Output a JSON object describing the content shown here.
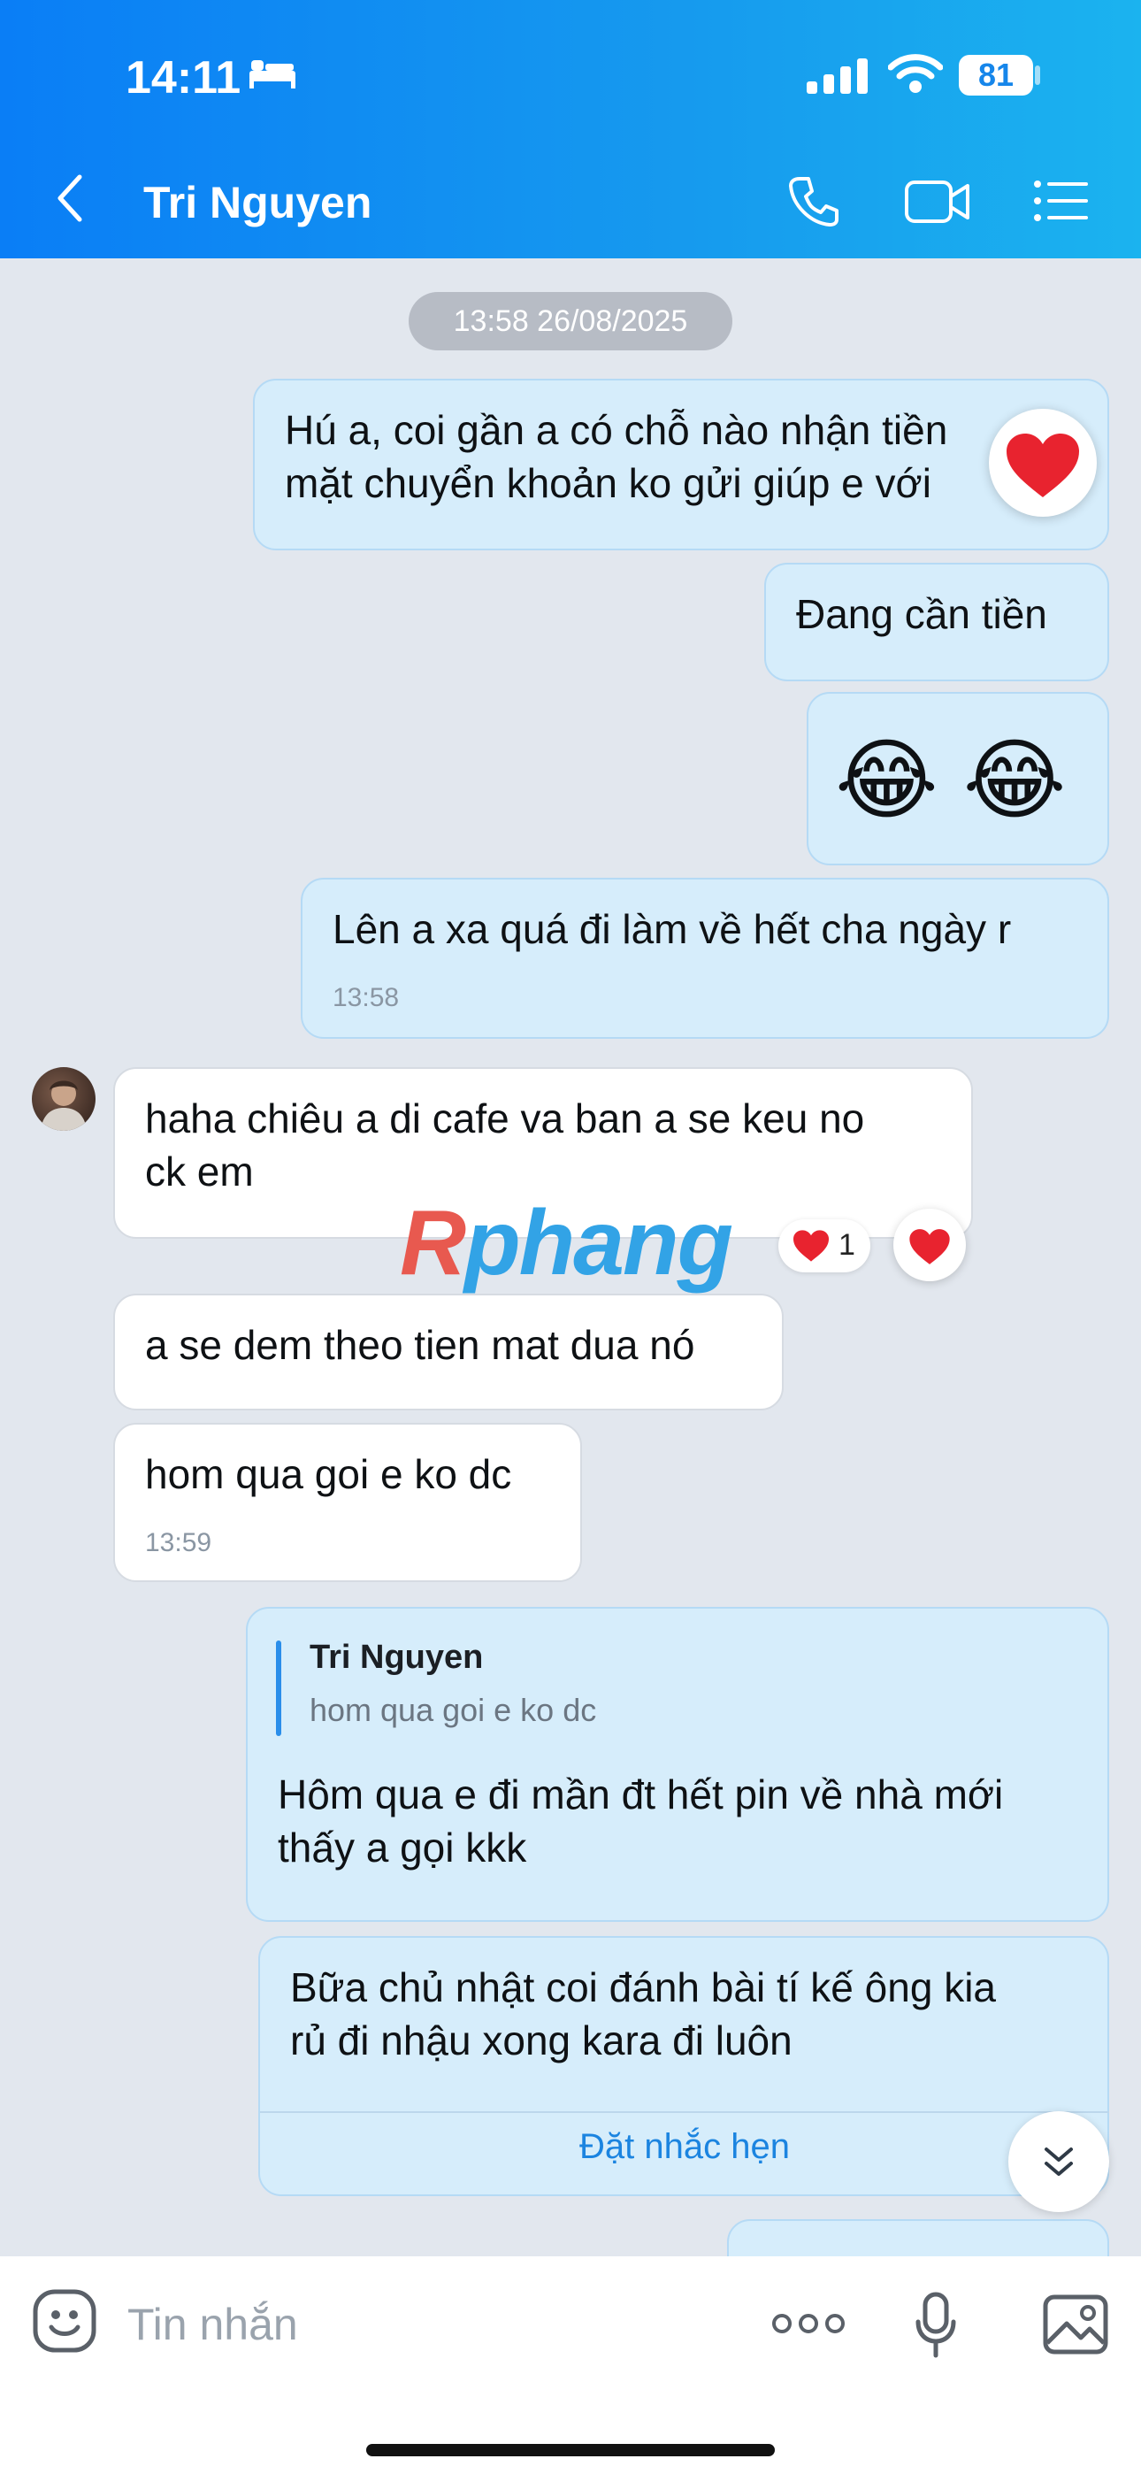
{
  "status_bar": {
    "time": "14:11",
    "battery": "81"
  },
  "header": {
    "contact_name": "Tri Nguyen"
  },
  "chat": {
    "date_separator": "13:58 26/08/2025",
    "messages": [
      {
        "direction": "out",
        "lines": [
          "Hú a, coi gần a có chỗ nào nhận tiền",
          "mặt chuyển khoản ko gửi giúp e với"
        ],
        "reaction": "❤️"
      },
      {
        "direction": "out",
        "lines": [
          "Đang cần tiền"
        ]
      },
      {
        "direction": "out",
        "lines": [
          "😂 😂"
        ]
      },
      {
        "direction": "out",
        "lines": [
          "Lên a xa quá đi làm về hết cha ngày r"
        ],
        "time": "13:58"
      },
      {
        "direction": "in",
        "lines": [
          "haha chiêu a di cafe va ban a se keu no",
          "ck em"
        ],
        "reaction_count": "1",
        "reaction": "❤️"
      },
      {
        "direction": "in",
        "lines": [
          "a se dem theo tien mat dua nó"
        ]
      },
      {
        "direction": "in",
        "lines": [
          "hom qua goi e ko dc"
        ],
        "time": "13:59"
      },
      {
        "direction": "out",
        "quote": {
          "name": "Tri Nguyen",
          "text": "hom qua goi e ko dc"
        },
        "lines": [
          "Hôm qua e đi mần đt hết pin về nhà mới",
          "thấy a gọi kkk"
        ]
      },
      {
        "direction": "out",
        "lines": [
          "Bữa chủ nhật coi đánh bài tí kế ông kia",
          "rủ đi nhậu xong kara đi luôn"
        ],
        "action": "Đặt nhắc hẹn"
      }
    ],
    "watermark": {
      "part1": "R",
      "part2": "phang"
    }
  },
  "composer": {
    "placeholder": "Tin nhắn"
  },
  "colors": {
    "header_gradient_start": "#0a7ef6",
    "header_gradient_end": "#1bb3ef",
    "outgoing_bubble": "#d6edfb",
    "incoming_bubble": "#ffffff",
    "chat_background": "#e2e7ee",
    "accent": "#1b84e0"
  },
  "icons": [
    "bed-icon",
    "signal-icon",
    "wifi-icon",
    "back-icon",
    "call-icon",
    "video-icon",
    "menu-icon",
    "heart-icon",
    "chevrons-down-icon",
    "sticker-icon",
    "more-icon",
    "mic-icon",
    "image-icon"
  ]
}
